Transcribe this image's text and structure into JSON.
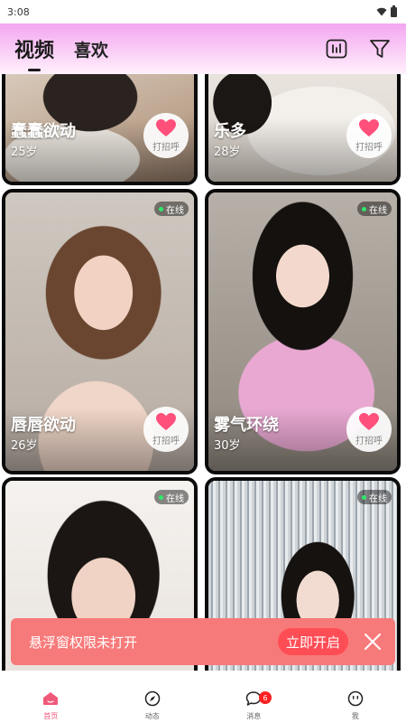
{
  "status_bar": {
    "time": "3:08"
  },
  "header": {
    "tabs": [
      {
        "label": "视频",
        "active": true
      },
      {
        "label": "喜欢",
        "active": false
      }
    ],
    "icons": [
      "equalizer-icon",
      "filter-icon"
    ]
  },
  "cards": [
    {
      "name": "蠢蠢欲动",
      "age": "25岁",
      "greet_label": "打招呼",
      "online": false
    },
    {
      "name": "乐多",
      "age": "28岁",
      "greet_label": "打招呼",
      "online": false
    },
    {
      "name": "唇唇欲动",
      "age": "26岁",
      "greet_label": "打招呼",
      "online": true,
      "online_label": "在线"
    },
    {
      "name": "雾气环绕",
      "age": "30岁",
      "greet_label": "打招呼",
      "online": true,
      "online_label": "在线"
    },
    {
      "online": true,
      "online_label": "在线"
    },
    {
      "online": true,
      "online_label": "在线"
    }
  ],
  "toast": {
    "message": "悬浮窗权限未打开",
    "action_label": "立即开启",
    "background_color": "#f77a7a"
  },
  "bottom_nav": {
    "items": [
      {
        "label": "首页",
        "icon": "home-icon",
        "active": true
      },
      {
        "label": "动态",
        "icon": "compass-icon",
        "active": false
      },
      {
        "label": "消息",
        "icon": "chat-bubble-icon",
        "active": false,
        "badge": "6"
      },
      {
        "label": "我",
        "icon": "profile-face-icon",
        "active": false
      }
    ]
  },
  "colors": {
    "accent": "#f05a7a",
    "heart": "#ff4f7b",
    "online_dot": "#2ee86a",
    "header_gradient_top": "#f3a6f0"
  }
}
